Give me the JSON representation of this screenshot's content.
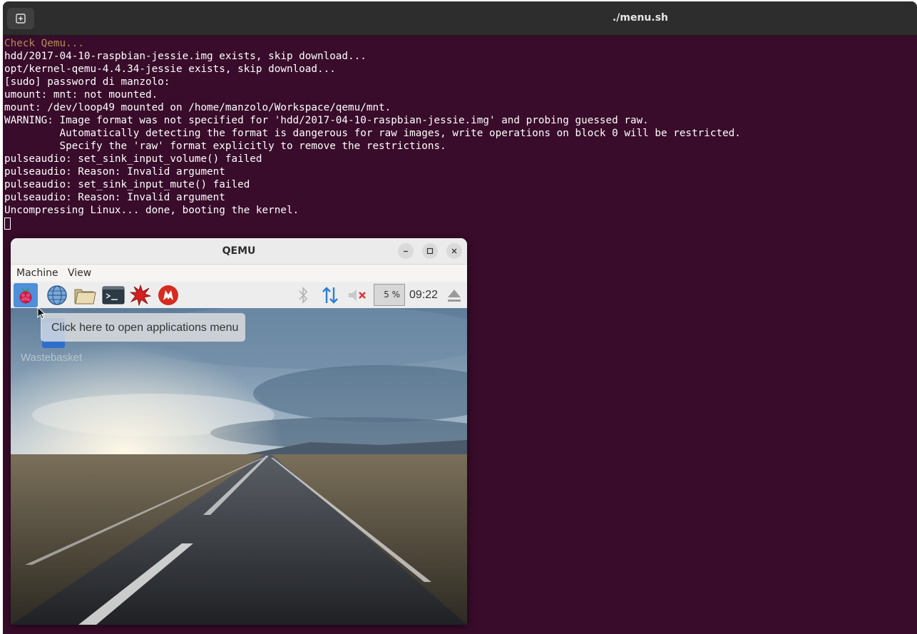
{
  "terminal": {
    "title": "./menu.sh",
    "lines": [
      "Check Qemu...",
      "hdd/2017-04-10-raspbian-jessie.img exists, skip download...",
      "opt/kernel-qemu-4.4.34-jessie exists, skip download...",
      "[sudo] password di manzolo:",
      "umount: mnt: not mounted.",
      "mount: /dev/loop49 mounted on /home/manzolo/Workspace/qemu/mnt.",
      "WARNING: Image format was not specified for 'hdd/2017-04-10-raspbian-jessie.img' and probing guessed raw.",
      "         Automatically detecting the format is dangerous for raw images, write operations on block 0 will be restricted.",
      "         Specify the 'raw' format explicitly to remove the restrictions.",
      "pulseaudio: set_sink_input_volume() failed",
      "pulseaudio: Reason: Invalid argument",
      "pulseaudio: set_sink_input_mute() failed",
      "pulseaudio: Reason: Invalid argument",
      "Uncompressing Linux... done, booting the kernel."
    ]
  },
  "qemu": {
    "title": "QEMU",
    "menu": {
      "machine": "Machine",
      "view": "View"
    },
    "panel": {
      "cpu_usage": "5 %",
      "clock": "09:22",
      "launchers": [
        "raspberry-menu-icon",
        "web-browser-icon",
        "file-manager-icon",
        "terminal-icon",
        "math-kernel-icon",
        "wolfram-icon"
      ]
    },
    "desktop": {
      "tooltip": "Click here to open applications menu",
      "wastebasket_label": "Wastebasket"
    }
  },
  "colors": {
    "terminal_bg": "#380c2a",
    "titlebar_bg": "#2d2d2d",
    "accent_blue": "#4f8fd9"
  }
}
